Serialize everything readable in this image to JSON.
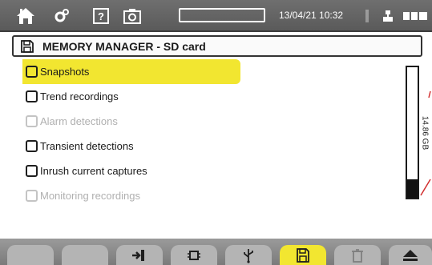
{
  "topbar": {
    "icons": [
      "home-icon",
      "settings-icon",
      "help-icon",
      "camera-icon",
      "status-bar",
      "usb-icon",
      "battery-icon"
    ],
    "datetime": "13/04/21 10:32"
  },
  "header": {
    "icon": "sd-card-icon",
    "title": "MEMORY MANAGER - SD card"
  },
  "list": {
    "items": [
      {
        "label": "Snapshots",
        "state": "selected"
      },
      {
        "label": "Trend recordings",
        "state": "enabled"
      },
      {
        "label": "Alarm detections",
        "state": "disabled"
      },
      {
        "label": "Transient detections",
        "state": "enabled"
      },
      {
        "label": "Inrush current captures",
        "state": "enabled"
      },
      {
        "label": "Monitoring recordings",
        "state": "disabled"
      }
    ]
  },
  "memory": {
    "capacity_label": "14.86 GB",
    "used_fraction": 0.14
  },
  "bottombar": {
    "tabs": [
      {
        "icon": "",
        "active": false
      },
      {
        "icon": "",
        "active": false
      },
      {
        "icon": "exit-icon",
        "active": false
      },
      {
        "icon": "chip-icon",
        "active": false
      },
      {
        "icon": "usb-icon",
        "active": false
      },
      {
        "icon": "sd-card-icon",
        "active": true
      },
      {
        "icon": "trash-icon",
        "active": false
      },
      {
        "icon": "eject-icon",
        "active": false
      }
    ]
  },
  "colors": {
    "accent": "#f2e630",
    "bar": "#636363",
    "tab": "#b4b4b4"
  }
}
